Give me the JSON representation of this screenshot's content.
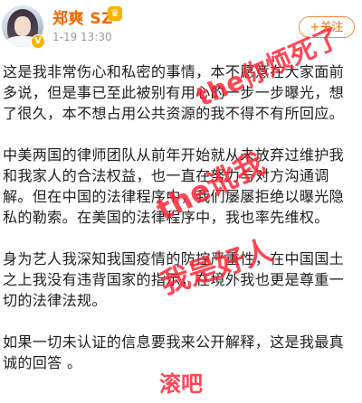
{
  "post": {
    "author": "郑爽 SZ",
    "timestamp": "1-19 13:30",
    "follow_label": "+关注"
  },
  "content": {
    "paragraphs": [
      [
        "这是我非常伤心和私密的事情，本不愿意在大家面前",
        "多说，但是事已至此被别有用心的一步一步曝光，想",
        "了很久，本不想占用公共资源的我不得不有所回应。"
      ],
      [
        "中美两国的律师团队从前年开始就从未放弃过维护我",
        "和我家人的合法权益，也一直在努力与对方沟通调",
        "解。但在中国的法律程序中，我们屡屡拒绝以曝光隐",
        "私的勒索。在美国的法律程序中，我也率先维权。"
      ],
      [
        "身为艺人我深知我国疫情的防控严重性，在中国国土",
        "之上我没有违背国家的指示，在境外我也更是尊重一",
        "切的法律法规。"
      ],
      [
        "如果一切未认证的信息要我来公开解释，这是我最真",
        "诚的回答 。"
      ]
    ]
  },
  "annotations": {
    "a1": "the你烦死了",
    "a2": "the讹我",
    "a3": "我是好人",
    "a4": "滚吧",
    "color": "#ff1f2f"
  },
  "colors": {
    "name": "#f86400",
    "follow_border": "#f58a3c",
    "time": "#999999"
  },
  "icons": {
    "verified": "yellow-v-badge",
    "vip": "vip-crown-badge"
  }
}
